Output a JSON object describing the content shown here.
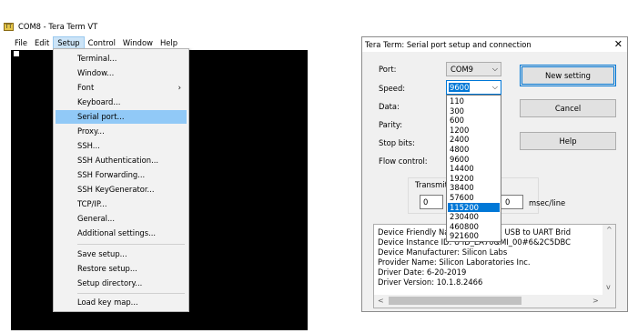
{
  "terminal_window": {
    "title": "COM8 - Tera Term VT",
    "icon": "tera-term-icon",
    "menubar": [
      {
        "label": "File"
      },
      {
        "label": "Edit"
      },
      {
        "label": "Setup"
      },
      {
        "label": "Control"
      },
      {
        "label": "Window"
      },
      {
        "label": "Help"
      }
    ],
    "setup_menu": {
      "items": [
        {
          "label": "Terminal..."
        },
        {
          "label": "Window..."
        },
        {
          "label": "Font",
          "submenu_arrow": "›"
        },
        {
          "label": "Keyboard..."
        },
        {
          "label": "Serial port..."
        },
        {
          "label": "Proxy..."
        },
        {
          "label": "SSH..."
        },
        {
          "label": "SSH Authentication..."
        },
        {
          "label": "SSH Forwarding..."
        },
        {
          "label": "SSH KeyGenerator..."
        },
        {
          "label": "TCP/IP..."
        },
        {
          "label": "General..."
        },
        {
          "label": "Additional settings..."
        },
        {
          "label": "Save setup..."
        },
        {
          "label": "Restore setup..."
        },
        {
          "label": "Setup directory..."
        },
        {
          "label": "Load key map..."
        }
      ],
      "highlighted": "Serial port..."
    }
  },
  "dialog": {
    "title": "Tera Term: Serial port setup and connection",
    "close_glyph": "✕",
    "port": {
      "label": "Port:",
      "value": "COM9"
    },
    "speed": {
      "label": "Speed:",
      "value": "9600",
      "options": [
        "110",
        "300",
        "600",
        "1200",
        "2400",
        "4800",
        "9600",
        "14400",
        "19200",
        "38400",
        "57600",
        "115200",
        "230400",
        "460800",
        "921600"
      ],
      "hovered_option": "115200"
    },
    "data": {
      "label": "Data:"
    },
    "parity": {
      "label": "Parity:"
    },
    "stop_bits": {
      "label": "Stop bits:"
    },
    "flow_control": {
      "label": "Flow control:"
    },
    "buttons": {
      "new_setting": "New setting",
      "cancel": "Cancel",
      "help": "Help"
    },
    "transmit_delay": {
      "label": "Transmit d",
      "char_value": "0",
      "line_value": "0",
      "line_unit": "msec/line"
    },
    "device_info": [
      "Device Friendly Nam                    ual CP2105 USB to UART Brid",
      "Device Instance ID: U                 ID_EA70&MI_00#6&2C5DBC",
      "Device Manufacturer: Silicon Labs",
      "Provider Name: Silicon Laboratories Inc.",
      "Driver Date: 6-20-2019",
      "Driver Version: 10.1.8.2466"
    ],
    "scroll_glyphs": {
      "up": "^",
      "down": "v",
      "left": "<",
      "right": ">",
      "chevron": "⌵"
    }
  },
  "colors": {
    "menu_highlight": "#91c9f7",
    "selection_blue": "#0078d7",
    "terminal_bg": "#000000"
  }
}
